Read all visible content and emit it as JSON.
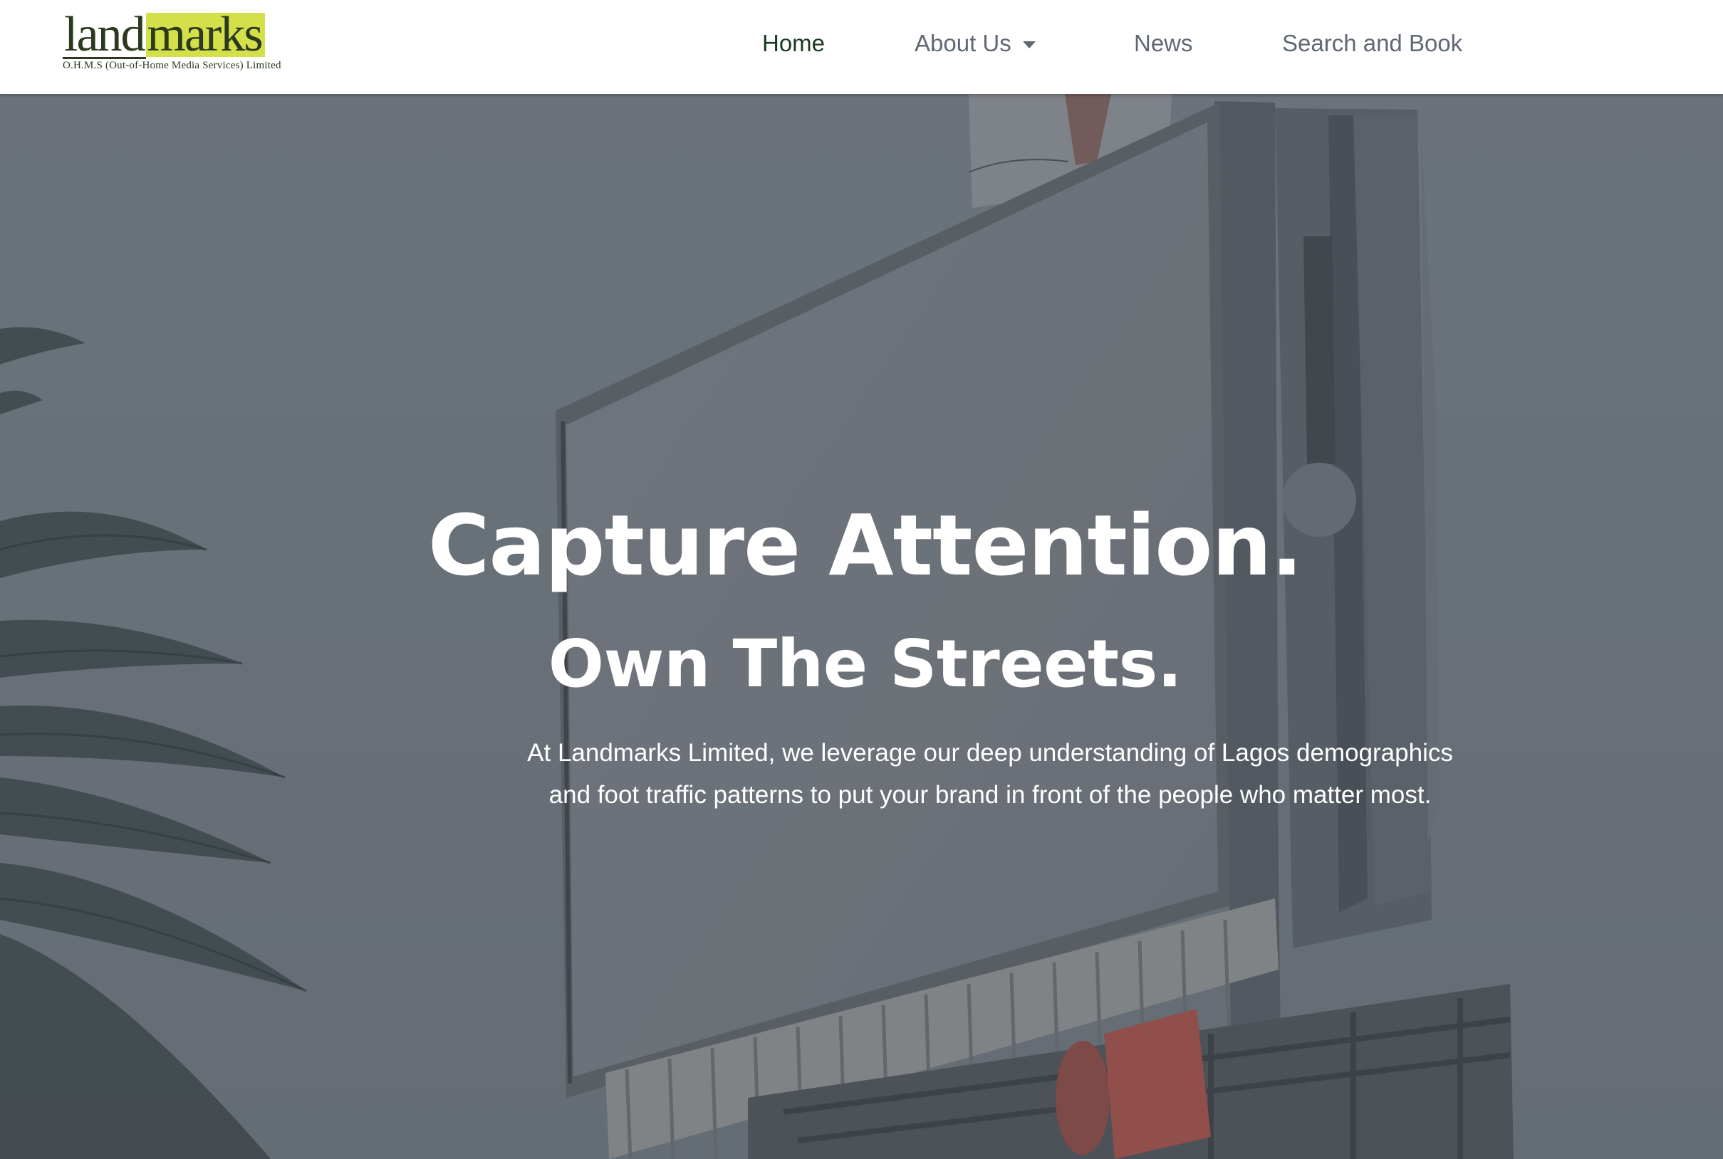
{
  "header": {
    "logo": {
      "word_part1": "land",
      "word_part2": "marks",
      "tagline": "O.H.M.S (Out-of-Home Media Services) Limited"
    },
    "nav": [
      {
        "label": "Home",
        "active": true
      },
      {
        "label": "About Us",
        "has_dropdown": true
      },
      {
        "label": "News"
      },
      {
        "label": "Search and Book"
      }
    ]
  },
  "hero": {
    "headline": "Capture Attention.",
    "subheadline": "Own The Streets.",
    "body_line1": "At Landmarks Limited, we leverage our deep understanding of Lagos demographics",
    "body_line2": "and foot traffic patterns to put your brand in front of the people who matter most."
  },
  "colors": {
    "logo_accent": "#d4e04a",
    "logo_dark": "#2b3a1e",
    "nav_active": "#1a3a22",
    "nav_text": "#5f6874",
    "hero_text": "#ffffff"
  }
}
